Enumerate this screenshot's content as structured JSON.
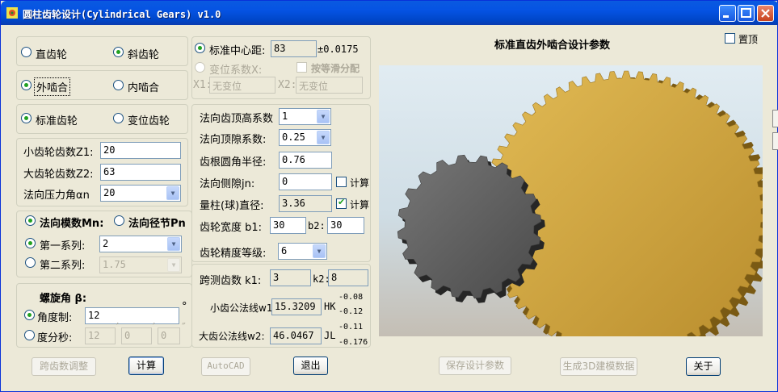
{
  "window": {
    "title": "圆柱齿轮设计(Cylindrical Gears) v1.0"
  },
  "gear_type": {
    "spur": "直齿轮",
    "helical": "斜齿轮",
    "selected": "helical"
  },
  "mesh_type": {
    "external": "外啮合",
    "internal": "内啮合",
    "selected": "external"
  },
  "modification": {
    "standard": "标准齿轮",
    "modified": "变位齿轮",
    "selected": "standard"
  },
  "teeth": {
    "z1_label": "小齿轮齿数Z1:",
    "z1": "20",
    "z2_label": "大齿轮齿数Z2:",
    "z2": "63",
    "alpha_label": "法向压力角αn",
    "alpha": "20"
  },
  "module": {
    "normal_module": "法向模数Mn:",
    "normal_pitch": "法向径节Pn",
    "series1_label": "第一系列:",
    "series1": "2",
    "series2_label": "第二系列:",
    "series2": "1.75"
  },
  "helix": {
    "title": "螺旋角  β:",
    "deg_label": "角度制:",
    "deg": "12",
    "deg_unit": "°",
    "dms_label": "度分秒:",
    "d": "12",
    "m": "0",
    "s": "0",
    "m_unit": "′",
    "s_unit": "″"
  },
  "center": {
    "std_label": "标准中心距:",
    "std": "83",
    "tol": "±0.0175",
    "coef_label": "变位系数X:",
    "equal_label": "按等滑分配",
    "x1_label": "X1:",
    "x1": "无变位",
    "x2_label": "X2:",
    "x2": "无变位"
  },
  "params": {
    "addendum_label": "法向齿顶高系数",
    "addendum": "1",
    "clearance_label": "法向顶隙系数:",
    "clearance": "0.25",
    "root_label": "齿根圆角半径:",
    "root": "0.76",
    "backlash_label": "法向侧隙jn:",
    "backlash": "0",
    "calc1": "计算",
    "pin_label": "量柱(球)直径:",
    "pin": "3.36",
    "calc2": "计算",
    "width_label": "齿轮宽度 b1:",
    "b1": "30",
    "b2_label": "b2:",
    "b2": "30",
    "grade_label": "齿轮精度等级:",
    "grade": "6"
  },
  "span": {
    "k_label": "跨测齿数 k1:",
    "k1": "3",
    "k2_label": "k2:",
    "k2": "8",
    "w1_label": "小齿公法线w1:",
    "w1": "15.3209",
    "w1_code": "HK",
    "w1_up": "-0.08",
    "w1_low": "-0.12",
    "w2_label": "大齿公法线w2:",
    "w2": "46.0467",
    "w2_code": "JL",
    "w2_up": "-0.11",
    "w2_low": "-0.176"
  },
  "preview": {
    "title": "标准直齿外啮合设计参数",
    "topmost": "置顶"
  },
  "buttons": {
    "span_adjust": "跨齿数调整",
    "calc": "计算",
    "autocad": "AutoCAD",
    "exit": "退出",
    "save": "保存设计参数",
    "gen3d": "生成3D建模数据",
    "about": "关于"
  },
  "gears": {
    "small_teeth": 20,
    "large_teeth": 63,
    "small_color": "#5c5c5c",
    "large_color": "#d0a63c"
  }
}
